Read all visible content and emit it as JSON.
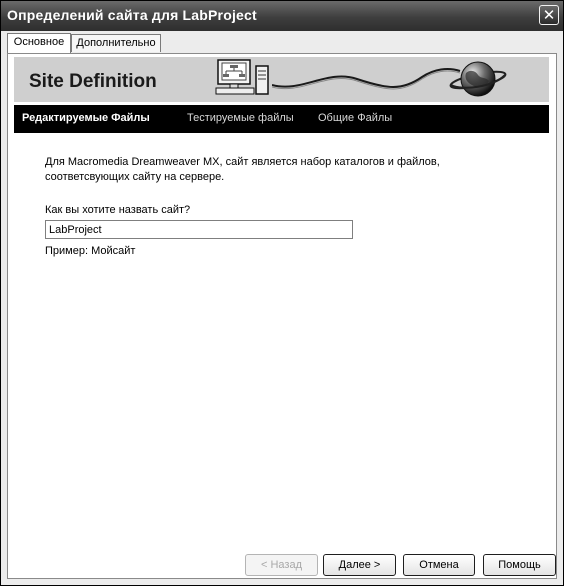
{
  "window": {
    "title": "Определений сайта для LabProject",
    "close_glyph": "✕"
  },
  "tabs": [
    {
      "label": "Основное",
      "active": true
    },
    {
      "label": "Дополнительно",
      "active": false
    }
  ],
  "banner": {
    "title": "Site Definition",
    "icons": [
      "computer-icon",
      "globe-icon"
    ]
  },
  "nav": [
    {
      "label": "Редактируемые Файлы",
      "active": true
    },
    {
      "label": "Тестируемые файлы",
      "active": false
    },
    {
      "label": "Общие Файлы",
      "active": false
    }
  ],
  "content": {
    "intro_line1": "Для Macromedia Dreamweaver MX, сайт является набор каталогов и файлов,",
    "intro_line2": "соответсвующих сайту на сервере.",
    "question": "Как вы хотите назвать сайт?",
    "site_name_value": "LabProject",
    "example": "Пример: Мойсайт"
  },
  "buttons": {
    "back": "< Назад",
    "next": "Далее >",
    "cancel": "Отмена",
    "help": "Помощь"
  }
}
